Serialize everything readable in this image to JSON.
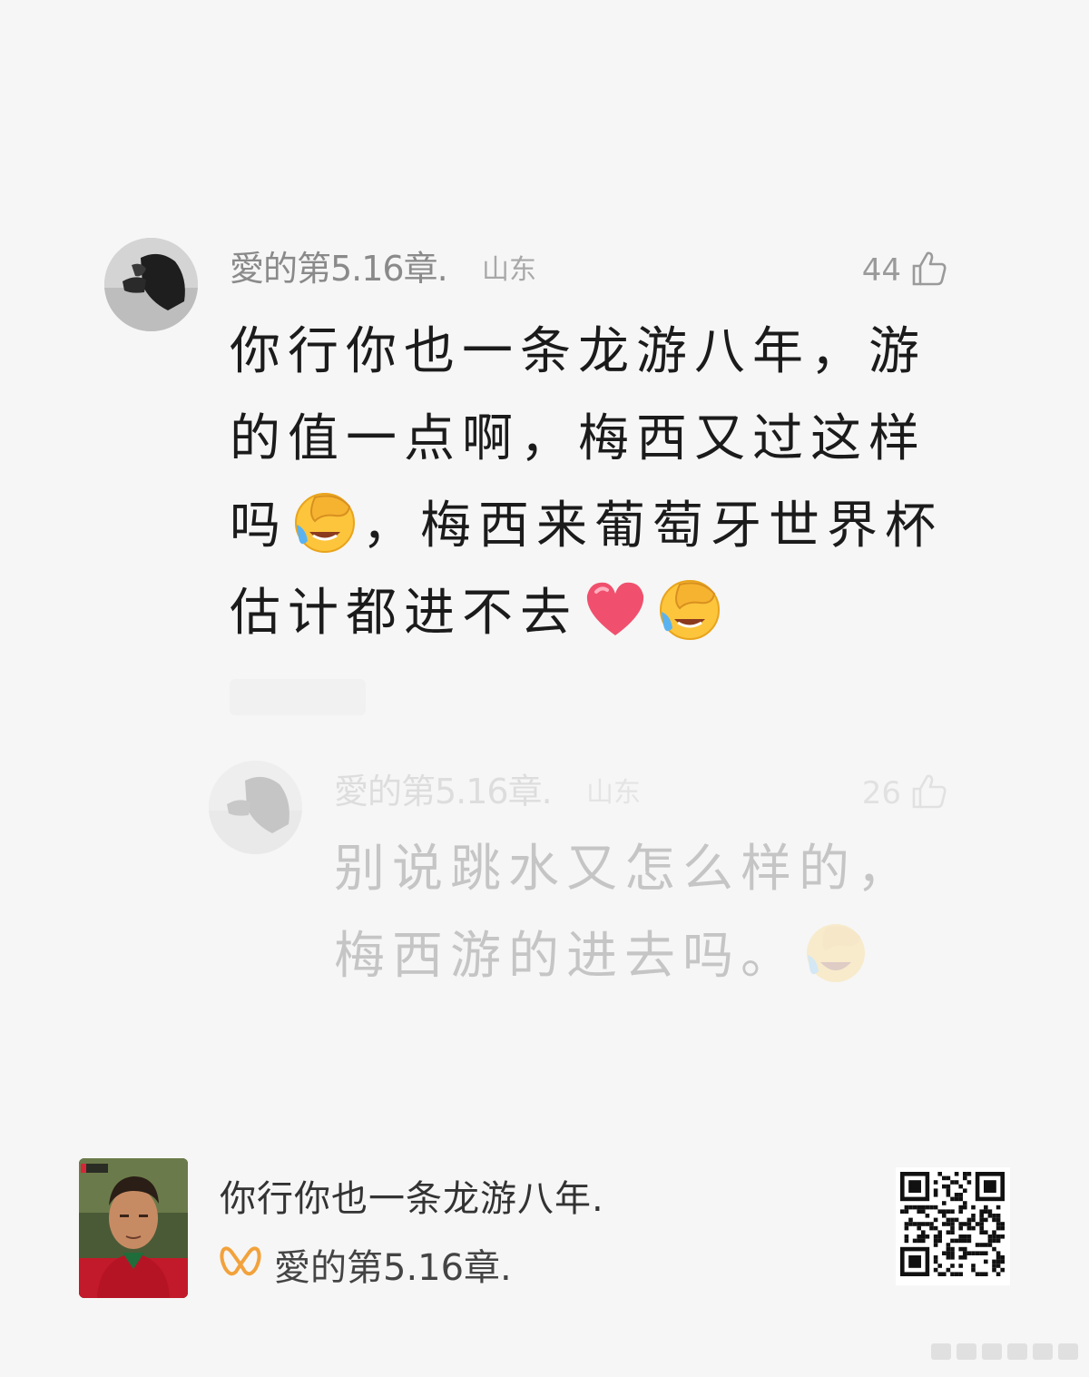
{
  "comment": {
    "username": "愛的第5.16章.",
    "location": "山东",
    "like_count": "44",
    "text_before_emoji1": "你行你也一条龙游八年，游的值一点啊，梅西又过这样吗",
    "text_mid": "，梅西来葡萄牙世界杯估计都进不去",
    "emojis": [
      "crying-laughing-facepalm",
      "red-heart",
      "crying-laughing-facepalm"
    ]
  },
  "reply": {
    "username": "愛的第5.16章.",
    "location": "山东",
    "like_count": "26",
    "text": "别说跳水又怎么样的，梅西游的进去吗。",
    "emojis": [
      "crying-laughing-facepalm"
    ]
  },
  "share_card": {
    "title": "你行你也一条龙游八年.",
    "author": "愛的第5.16章.",
    "icons": [
      "logo-icon",
      "qr-code"
    ]
  },
  "colors": {
    "background": "#f6f6f6",
    "text_primary": "#1b1b1b",
    "text_secondary": "#8a8a8a",
    "logo_orange": "#f2a23c"
  }
}
